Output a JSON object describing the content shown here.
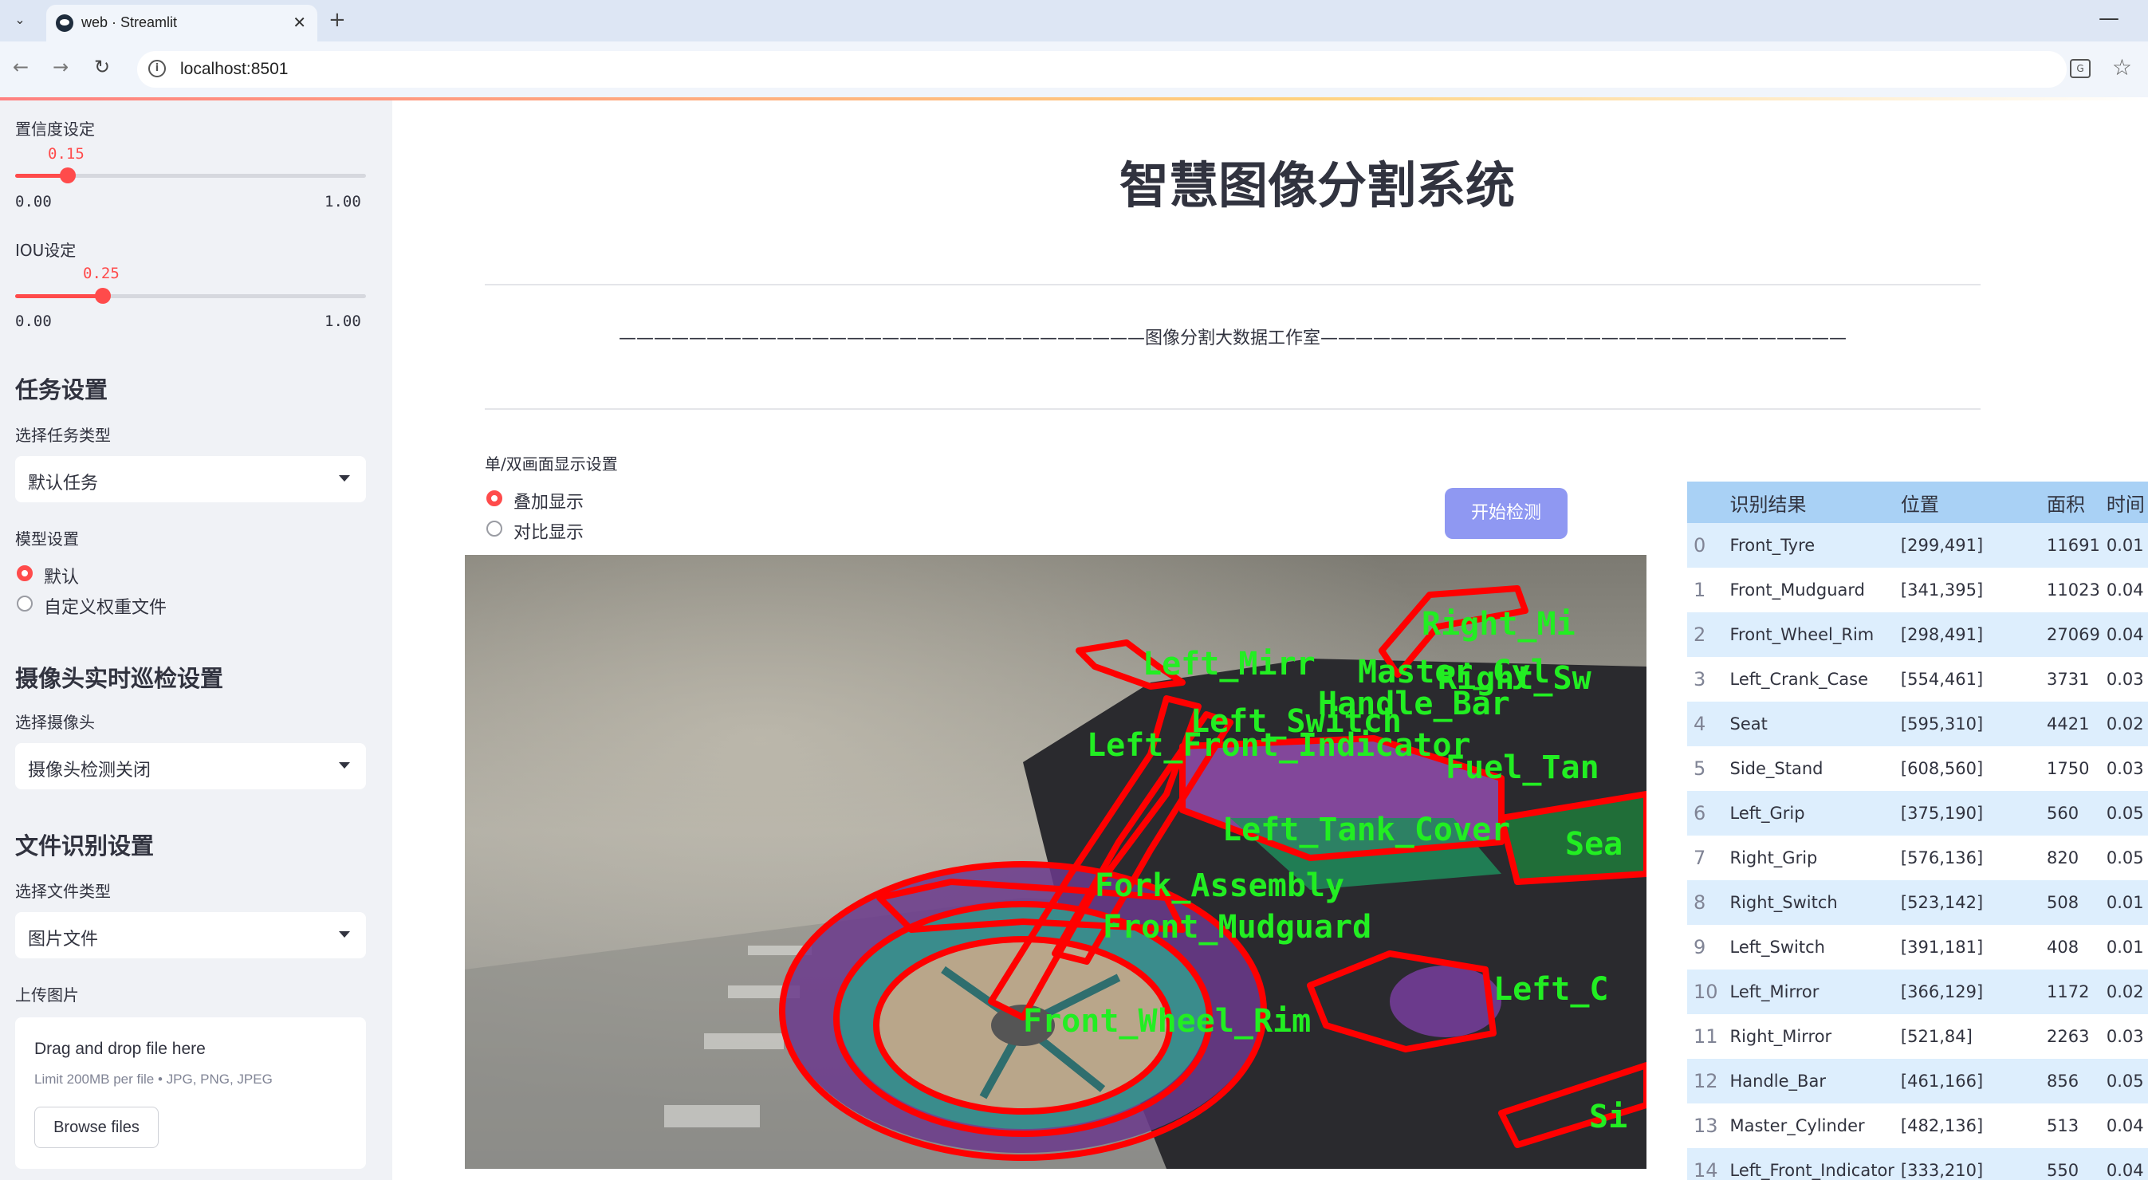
{
  "browser": {
    "tab_title": "web · Streamlit",
    "url": "localhost:8501"
  },
  "sidebar": {
    "confidence": {
      "label": "置信度设定",
      "value": "0.15",
      "value_fraction": 0.15,
      "min": "0.00",
      "max": "1.00"
    },
    "iou": {
      "label": "IOU设定",
      "value": "0.25",
      "value_fraction": 0.25,
      "min": "0.00",
      "max": "1.00"
    },
    "task_heading": "任务设置",
    "task_type_label": "选择任务类型",
    "task_type_value": "默认任务",
    "model_label": "模型设置",
    "model_options": [
      "默认",
      "自定义权重文件"
    ],
    "model_selected": "默认",
    "camera_heading": "摄像头实时巡检设置",
    "camera_label": "选择摄像头",
    "camera_value": "摄像头检测关闭",
    "file_heading": "文件识别设置",
    "file_type_label": "选择文件类型",
    "file_type_value": "图片文件",
    "upload_label": "上传图片",
    "upload_title": "Drag and drop file here",
    "upload_limit": "Limit 200MB per file • JPG, PNG, JPEG",
    "browse_label": "Browse files"
  },
  "main": {
    "title": "智慧图像分割系统",
    "studio_line": "——————————————————————————————图像分割大数据工作室——————————————————————————————",
    "mode_label": "单/双画面显示设置",
    "mode_options": [
      "叠加显示",
      "对比显示"
    ],
    "mode_selected": "叠加显示",
    "start_button": "开始检测",
    "overlay_labels": [
      "Right_Mi",
      "Left_Mirr",
      "Master_Cyl",
      "Right_Sw",
      "Handle_Bar",
      "Left_Switch",
      "Left_Front_Indicator",
      "Fuel_Tan",
      "Left_Tank_Cover",
      "Sea",
      "Fork_Assembly",
      "Front_Mudguard",
      "Left_C",
      "Front_Wheel_Rim",
      "Si"
    ]
  },
  "table": {
    "columns": [
      "",
      "识别结果",
      "位置",
      "面积",
      "时间"
    ],
    "rows": [
      [
        "0",
        "Front_Tyre",
        "[299,491]",
        "11691",
        "0.01"
      ],
      [
        "1",
        "Front_Mudguard",
        "[341,395]",
        "11023",
        "0.04"
      ],
      [
        "2",
        "Front_Wheel_Rim",
        "[298,491]",
        "27069",
        "0.04"
      ],
      [
        "3",
        "Left_Crank_Case",
        "[554,461]",
        "3731",
        "0.03"
      ],
      [
        "4",
        "Seat",
        "[595,310]",
        "4421",
        "0.02"
      ],
      [
        "5",
        "Side_Stand",
        "[608,560]",
        "1750",
        "0.03"
      ],
      [
        "6",
        "Left_Grip",
        "[375,190]",
        "560",
        "0.05"
      ],
      [
        "7",
        "Right_Grip",
        "[576,136]",
        "820",
        "0.05"
      ],
      [
        "8",
        "Right_Switch",
        "[523,142]",
        "508",
        "0.01"
      ],
      [
        "9",
        "Left_Switch",
        "[391,181]",
        "408",
        "0.01"
      ],
      [
        "10",
        "Left_Mirror",
        "[366,129]",
        "1172",
        "0.02"
      ],
      [
        "11",
        "Right_Mirror",
        "[521,84]",
        "2263",
        "0.03"
      ],
      [
        "12",
        "Handle_Bar",
        "[461,166]",
        "856",
        "0.05"
      ],
      [
        "13",
        "Master_Cylinder",
        "[482,136]",
        "513",
        "0.04"
      ],
      [
        "14",
        "Left_Front_Indicator",
        "[333,210]",
        "550",
        "0.04"
      ]
    ]
  }
}
